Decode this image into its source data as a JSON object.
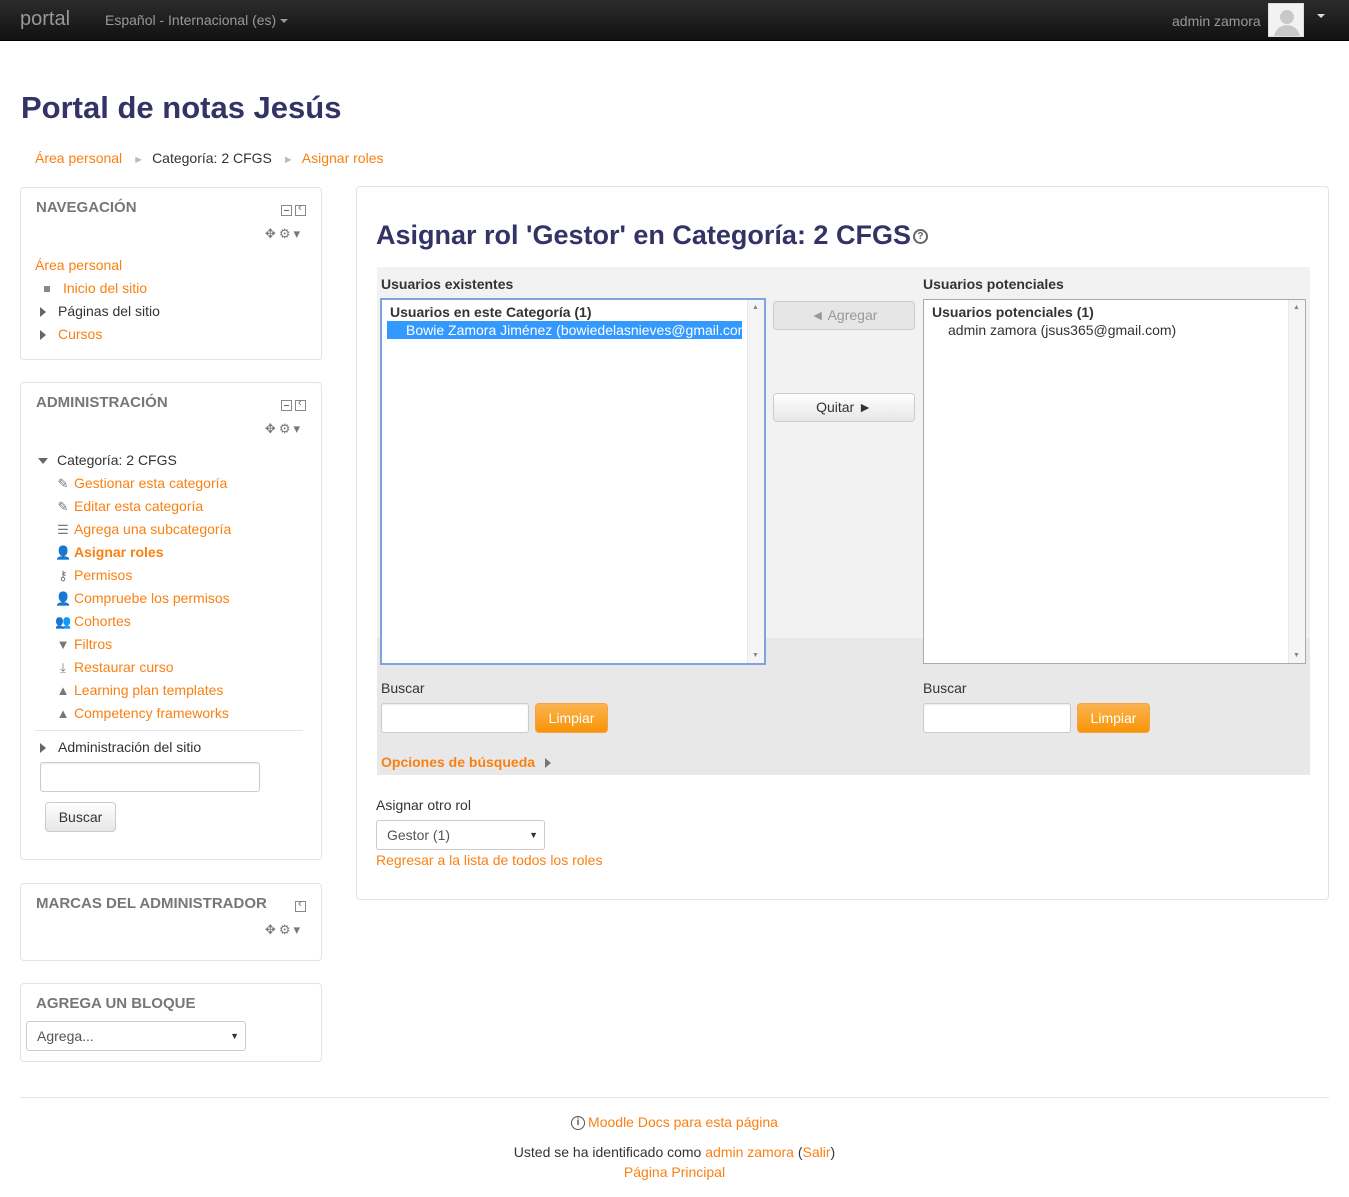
{
  "navbar": {
    "brand": "portal",
    "language": "Español - Internacional (es)",
    "user_name": "admin zamora"
  },
  "page": {
    "heading": "Portal de notas Jesús",
    "breadcrumb": [
      "Área personal",
      "Categoría: 2 CFGS",
      "Asignar roles"
    ]
  },
  "navigation_block": {
    "title": "NAVEGACIÓN",
    "items": [
      "Área personal",
      "Inicio del sitio",
      "Páginas del sitio",
      "Cursos"
    ]
  },
  "admin_block": {
    "title": "ADMINISTRACIÓN",
    "category": "Categoría: 2 CFGS",
    "items": [
      {
        "label": "Gestionar esta categoría",
        "icon": "pencil-icon"
      },
      {
        "label": "Editar esta categoría",
        "icon": "pencil-icon"
      },
      {
        "label": "Agrega una subcategoría",
        "icon": "subcategory-icon"
      },
      {
        "label": "Asignar roles",
        "icon": "assign-role-icon"
      },
      {
        "label": "Permisos",
        "icon": "key-icon"
      },
      {
        "label": "Compruebe los permisos",
        "icon": "check-permissions-icon"
      },
      {
        "label": "Cohortes",
        "icon": "cohorts-icon"
      },
      {
        "label": "Filtros",
        "icon": "filter-icon"
      },
      {
        "label": "Restaurar curso",
        "icon": "restore-icon"
      },
      {
        "label": "Learning plan templates",
        "icon": "plan-icon"
      },
      {
        "label": "Competency frameworks",
        "icon": "competency-icon"
      }
    ],
    "site_admin": "Administración del sitio",
    "search_value": "",
    "search_button": "Buscar"
  },
  "marks_block": {
    "title": "MARCAS DEL ADMINISTRADOR"
  },
  "add_block": {
    "title": "AGREGA UN BLOQUE",
    "select_value": "Agrega..."
  },
  "main": {
    "title": "Asignar rol 'Gestor' en Categoría: 2 CFGS",
    "existing": {
      "label": "Usuarios existentes",
      "group": "Usuarios en este Categoría (1)",
      "users": [
        "Bowie Zamora Jiménez (bowiedelasnieves@gmail.com)"
      ]
    },
    "potential": {
      "label": "Usuarios potenciales",
      "group": "Usuarios potenciales (1)",
      "users": [
        "admin zamora (jsus365@gmail.com)"
      ]
    },
    "add_button": "◄ Agregar",
    "remove_button": "Quitar ►",
    "search_label": "Buscar",
    "left_search_value": "",
    "right_search_value": "",
    "clear_button": "Limpiar",
    "search_options": "Opciones de búsqueda",
    "other_role_label": "Asignar otro rol",
    "other_role_value": "Gestor (1)",
    "back_link": "Regresar a la lista de todos los roles"
  },
  "footer": {
    "docs_link": "Moodle Docs para esta página",
    "logged_prefix": "Usted se ha identificado como",
    "logged_user": "admin zamora",
    "logout": "Salir",
    "home_link": "Página Principal"
  },
  "colors": {
    "link": "#f98012",
    "heading": "#333366",
    "selection": "#3399ff",
    "warning_button": "#f89406"
  }
}
